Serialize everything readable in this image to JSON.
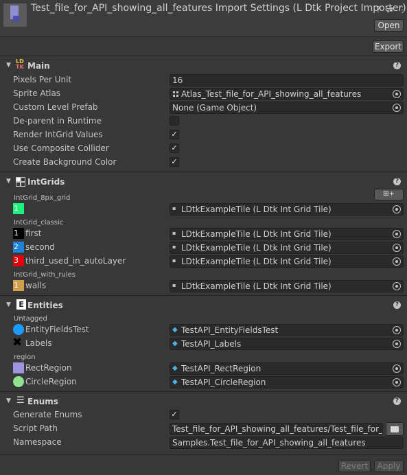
{
  "header": {
    "title": "Test_file_for_API_showing_all_features Import Settings (L Dtk Project Importer)",
    "open_label": "Open",
    "icons": [
      "help-icon",
      "preset-icon",
      "menu-icon"
    ]
  },
  "toolbar": {
    "export_label": "Export"
  },
  "main": {
    "title": "Main",
    "logo_text": [
      "LD",
      "TK"
    ],
    "rows": {
      "pixels_per_unit": {
        "label": "Pixels Per Unit",
        "value": "16"
      },
      "sprite_atlas": {
        "label": "Sprite Atlas",
        "value": "Atlas_Test_file_for_API_showing_all_features"
      },
      "custom_level_prefab": {
        "label": "Custom Level Prefab",
        "value": "None (Game Object)"
      },
      "deparent": {
        "label": "De-parent in Runtime",
        "checked": false
      },
      "render_intgrid": {
        "label": "Render IntGrid Values",
        "checked": true
      },
      "composite_collider": {
        "label": "Use Composite Collider",
        "checked": true
      },
      "bg_color": {
        "label": "Create Background Color",
        "checked": true
      }
    }
  },
  "intgrids": {
    "title": "IntGrids",
    "layers": [
      {
        "name": "IntGrid_8px_grid",
        "values": [
          {
            "index": "1",
            "name": "",
            "color": "#1df27f",
            "tile": "LDtkExampleTile (L Dtk Int Grid Tile)"
          }
        ]
      },
      {
        "name": "IntGrid_classic",
        "values": [
          {
            "index": "1",
            "name": "first",
            "color": "#000000",
            "tile": "LDtkExampleTile (L Dtk Int Grid Tile)"
          },
          {
            "index": "2",
            "name": "second",
            "color": "#1d83d8",
            "tile": "LDtkExampleTile (L Dtk Int Grid Tile)"
          },
          {
            "index": "3",
            "name": "third_used_in_autoLayer",
            "color": "#e3000b",
            "tile": "LDtkExampleTile (L Dtk Int Grid Tile)"
          }
        ]
      },
      {
        "name": "IntGrid_with_rules",
        "values": [
          {
            "index": "1",
            "name": "walls",
            "color": "#d09f4b",
            "tile": "LDtkExampleTile (L Dtk Int Grid Tile)"
          }
        ]
      }
    ]
  },
  "entities": {
    "title": "Entities",
    "groups": [
      {
        "name": "Untagged",
        "items": [
          {
            "name": "EntityFieldsTest",
            "color": "#1e9bff",
            "shape": "circle",
            "prefab": "TestAPI_EntityFieldsTest"
          },
          {
            "name": "Labels",
            "color": "#000000",
            "shape": "cross",
            "prefab": "TestAPI_Labels"
          }
        ]
      },
      {
        "name": "region",
        "items": [
          {
            "name": "RectRegion",
            "color": "#9c94dd",
            "shape": "square",
            "prefab": "TestAPI_RectRegion"
          },
          {
            "name": "CircleRegion",
            "color": "#8fe08f",
            "shape": "circle",
            "prefab": "TestAPI_CircleRegion"
          }
        ]
      }
    ]
  },
  "enums": {
    "title": "Enums",
    "generate": {
      "label": "Generate Enums",
      "checked": true
    },
    "script_path": {
      "label": "Script Path",
      "value": "Test_file_for_API_showing_all_features/Test_file_for_API"
    },
    "namespace": {
      "label": "Namespace",
      "value": "Samples.Test_file_for_API_showing_all_features"
    }
  },
  "footer": {
    "revert_label": "Revert",
    "apply_label": "Apply"
  }
}
